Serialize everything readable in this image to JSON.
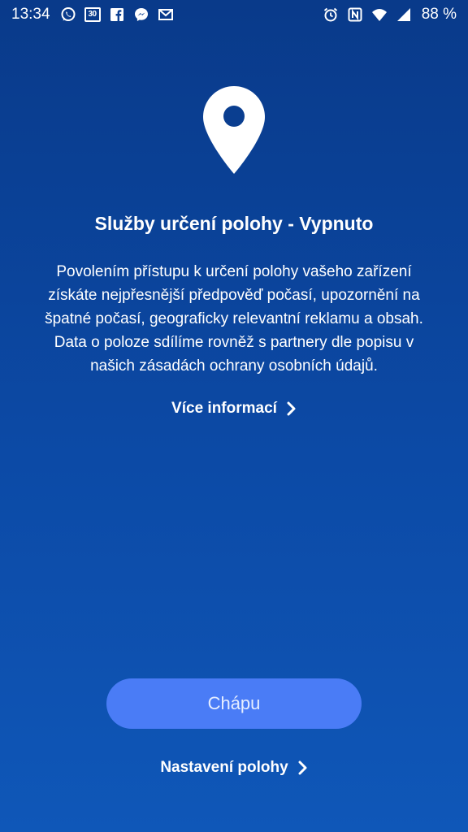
{
  "status_bar": {
    "time": "13:34",
    "calendar_day": "30",
    "battery_percent": "88 %",
    "left_icons": [
      "whatsapp-icon",
      "calendar-icon",
      "facebook-icon",
      "messenger-icon",
      "gmail-icon"
    ],
    "right_icons": [
      "alarm-icon",
      "nfc-icon",
      "wifi-icon",
      "signal-icon"
    ]
  },
  "main": {
    "icon": "location-pin-icon",
    "title": "Služby určení polohy - Vypnuto",
    "description": "Povolením přístupu k určení polohy vašeho zařízení získáte nejpřesnější předpověď počasí, upozornění na špatné počasí, geograficky relevantní reklamu a obsah. Data o poloze sdílíme rovněž s partnery dle popisu v našich zásadách ochrany osobních údajů.",
    "more_info_label": "Více informací"
  },
  "actions": {
    "primary_label": "Chápu",
    "settings_label": "Nastavení polohy"
  },
  "colors": {
    "background_top": "#093a8a",
    "background_bottom": "#0f57b8",
    "button": "#4a7cf6"
  }
}
